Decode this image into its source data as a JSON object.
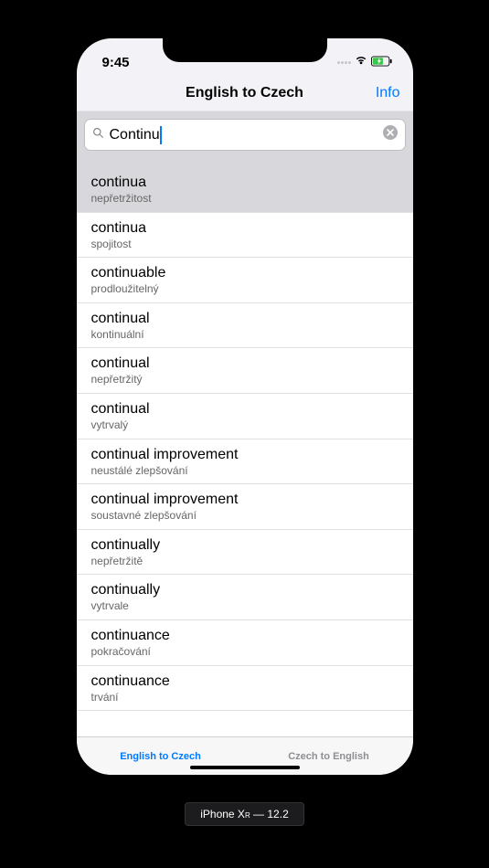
{
  "status": {
    "time": "9:45"
  },
  "nav": {
    "title": "English to Czech",
    "info": "Info"
  },
  "search": {
    "value": "Continu"
  },
  "results": [
    {
      "word": "continua",
      "translation": "nepřetržitost",
      "selected": true
    },
    {
      "word": "continua",
      "translation": "spojitost",
      "selected": false
    },
    {
      "word": "continuable",
      "translation": "prodloužitelný",
      "selected": false
    },
    {
      "word": "continual",
      "translation": "kontinuální",
      "selected": false
    },
    {
      "word": "continual",
      "translation": "nepřetržitý",
      "selected": false
    },
    {
      "word": "continual",
      "translation": "vytrvalý",
      "selected": false
    },
    {
      "word": "continual improvement",
      "translation": "neustálé zlepšování",
      "selected": false
    },
    {
      "word": "continual improvement",
      "translation": "soustavné zlepšování",
      "selected": false
    },
    {
      "word": "continually",
      "translation": "nepřetržitě",
      "selected": false
    },
    {
      "word": "continually",
      "translation": "vytrvale",
      "selected": false
    },
    {
      "word": "continuance",
      "translation": "pokračování",
      "selected": false
    },
    {
      "word": "continuance",
      "translation": "trvání",
      "selected": false
    }
  ],
  "tabs": {
    "active": "English to Czech",
    "inactive": "Czech to English"
  },
  "device": {
    "label_prefix": "iPhone X",
    "label_r": "R",
    "label_suffix": " — 12.2"
  }
}
